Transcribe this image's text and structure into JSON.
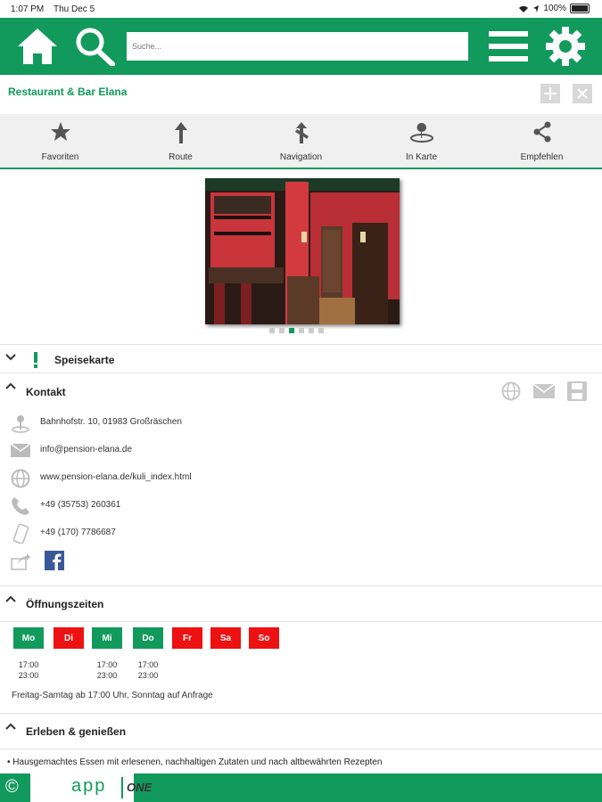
{
  "status": {
    "time": "1:07 PM",
    "date": "Thu Dec 5",
    "battery": "100%"
  },
  "toolbar": {
    "search_placeholder": "Suche..."
  },
  "page": {
    "title": "Restaurant & Bar Elana"
  },
  "actions": [
    {
      "label": "Favoriten",
      "icon": "star-icon"
    },
    {
      "label": "Route",
      "icon": "route-arrow-icon"
    },
    {
      "label": "Navigation",
      "icon": "navigation-icon"
    },
    {
      "label": "In Karte",
      "icon": "map-pin-icon"
    },
    {
      "label": "Empfehlen",
      "icon": "share-icon"
    }
  ],
  "gallery": {
    "count": 6,
    "active_index": 2
  },
  "sections": {
    "menu": "Speisekarte",
    "contact": "Kontakt",
    "hours": "Öffnungszeiten",
    "experience": "Erleben & genießen"
  },
  "contact": {
    "address": "Bahnhofstr. 10, 01983 Großräschen",
    "email": "info@pension-elana.de",
    "web": "www.pension-elana.de/kuli_index.html",
    "phone": "+49 (35753) 260361",
    "mobile": "+49 (170) 7786687"
  },
  "hours": {
    "days": [
      {
        "label": "Mo",
        "open": true,
        "from": "17:00",
        "to": "23:00"
      },
      {
        "label": "Di",
        "open": false,
        "from": "",
        "to": ""
      },
      {
        "label": "Mi",
        "open": true,
        "from": "17:00",
        "to": "23:00"
      },
      {
        "label": "Do",
        "open": true,
        "from": "17:00",
        "to": "23:00"
      },
      {
        "label": "Fr",
        "open": false,
        "from": "",
        "to": ""
      },
      {
        "label": "Sa",
        "open": false,
        "from": "",
        "to": ""
      },
      {
        "label": "So",
        "open": false,
        "from": "",
        "to": ""
      }
    ],
    "note": "Freitag-Samtag ab 17:00 Uhr, Sonntag auf Anfrage"
  },
  "experience": {
    "items": [
      "Hausgemachtes Essen mit erlesenen, nachhaltigen Zutaten und nach altbewährten Rezepten"
    ]
  },
  "footer": {
    "copyright": "©",
    "app": "app",
    "one": "ONE"
  },
  "colors": {
    "brand": "#119a5c",
    "closed": "#ee1111",
    "bar": "#f0f0f0"
  }
}
